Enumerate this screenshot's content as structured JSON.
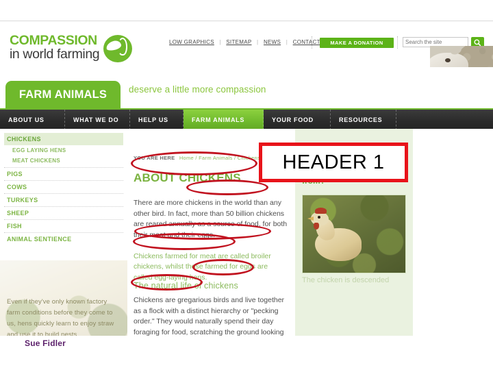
{
  "site": {
    "brand": {
      "line1": "COMPASSION",
      "line2": "in world farming",
      "logo_icon": "compassion-circle-logo",
      "green": "#6fb92c"
    },
    "utility_nav": {
      "links": [
        "LOW GRAPHICS",
        "SITEMAP",
        "NEWS",
        "CONTACT US"
      ],
      "separator": "|",
      "donate_label": "MAKE A DONATION",
      "search_placeholder": "Search the site",
      "search_value": "",
      "search_icon": "magnifier-icon"
    },
    "banner": {
      "tab_label": "FARM ANIMALS",
      "strapline": "deserve a little more compassion",
      "photo_alt": "sheep-photo"
    },
    "main_nav": [
      {
        "label": "ABOUT US",
        "active": false
      },
      {
        "label": "WHAT WE DO",
        "active": false
      },
      {
        "label": "HELP US",
        "active": false
      },
      {
        "label": "FARM ANIMALS",
        "active": true
      },
      {
        "label": "YOUR FOOD",
        "active": false
      },
      {
        "label": "RESOURCES",
        "active": false
      }
    ],
    "sidebar": [
      {
        "label": "CHICKENS",
        "level": "top",
        "current": true
      },
      {
        "label": "EGG LAYING HENS",
        "level": "sub",
        "current": false
      },
      {
        "label": "MEAT CHICKENS",
        "level": "sub",
        "current": false
      },
      {
        "label": "PIGS",
        "level": "top",
        "current": false
      },
      {
        "label": "COWS",
        "level": "top",
        "current": false
      },
      {
        "label": "TURKEYS",
        "level": "top",
        "current": false
      },
      {
        "label": "SHEEP",
        "level": "top",
        "current": false
      },
      {
        "label": "FISH",
        "level": "top",
        "current": false
      },
      {
        "label": "ANIMAL SENTIENCE",
        "level": "top",
        "current": false
      }
    ],
    "sidebar_quote": "Even if they've only known factory farm conditions before they come to us, hens quickly learn to enjoy straw and use it to build nests",
    "main": {
      "breadcrumb_label": "YOU ARE HERE",
      "breadcrumb_path": "Home / Farm Animals / Chickens",
      "heading": "ABOUT CHICKENS",
      "paragraph1": "There are more chickens in the world than any other bird. In fact, more than 50 billion chickens are reared annually as a source of food, for both their meat and their eggs.",
      "paragraph2": "Chickens farmed for meat are called broiler chickens, whilst those farmed for eggs are called egg-laying hens.",
      "subheading": "The natural life of chickens",
      "paragraph3": "Chickens are gregarious birds and live together as a flock with a distinct hierarchy or \"pecking order.\" They would naturally spend their day foraging for food, scratching the ground looking for insects and seeds."
    },
    "right_panel": {
      "title": "Where do chickens come from?",
      "photo_alt": "chicken-photo",
      "caption": "The chicken is descended from"
    }
  },
  "annotations": {
    "header_box_label": "HEADER 1",
    "box_border_color": "#e8131a",
    "ellipse_color": "#c1121f"
  },
  "footer": {
    "author": "Sue Fidler",
    "author_color": "#5b1f6a"
  }
}
